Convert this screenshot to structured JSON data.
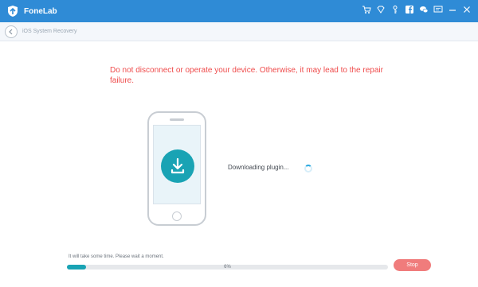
{
  "app": {
    "title": "FoneLab",
    "icons": [
      "cart-icon",
      "diamond-icon",
      "key-icon",
      "facebook-icon",
      "chat-icon",
      "feedback-icon",
      "minimize-icon",
      "close-icon"
    ]
  },
  "nav": {
    "breadcrumb": "iOS System Recovery"
  },
  "main": {
    "warning": "Do not disconnect or operate your device. Otherwise, it may lead to the repair failure.",
    "status": "Downloading plugin...",
    "wait_message": "It will take some time. Please wait a moment.",
    "progress": {
      "percent": 6,
      "label": "6%"
    },
    "stop_label": "Stop"
  },
  "colors": {
    "titlebar": "#2f8bd6",
    "accent": "#19a3b4",
    "warning": "#ef4b4b",
    "stop": "#f07c7c"
  }
}
